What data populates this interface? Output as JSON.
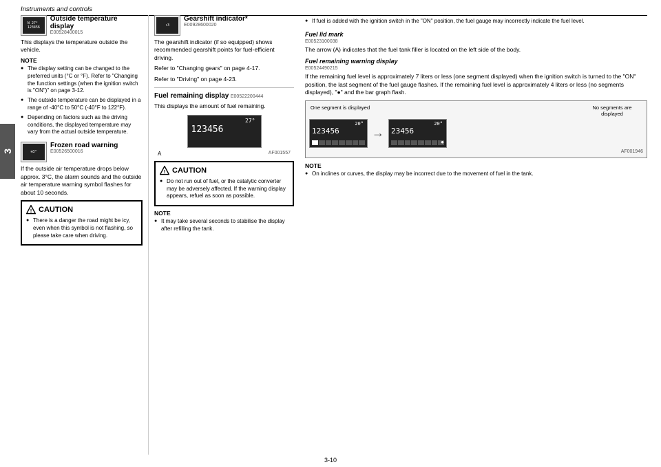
{
  "header": {
    "title": "Instruments and controls"
  },
  "footer": {
    "page_number": "3-10"
  },
  "sidebar": {
    "tab_label": "3"
  },
  "left_column": {
    "outside_temp_section": {
      "title": "Outside temperature display",
      "code": "E00528400015",
      "body": "This displays the temperature outside the vehicle.",
      "note_label": "NOTE",
      "note_items": [
        "The display setting can be changed to the preferred units (°C or °F). Refer to \"Changing the function settings (when the ignition switch is \"ON\")\" on page 3-12.",
        "The outside temperature can be displayed in a range of -40°C to 50°C (-40°F to 122°F).",
        "Depending on factors such as the driving conditions, the displayed temperature may vary from the actual outside temperature."
      ]
    },
    "frozen_section": {
      "title": "Frozen road warning",
      "code": "E00526500016",
      "body": "If the outside air temperature drops below approx. 3°C, the alarm sounds and the outside air temperature warning symbol flashes for about 10 seconds.",
      "caution_title": "CAUTION",
      "caution_items": [
        "There is a danger the road might be icy, even when this symbol is not flashing, so please take care when driving."
      ]
    }
  },
  "mid_column": {
    "gearshift_section": {
      "title": "Gearshift indicator*",
      "code": "E00928600020",
      "body": "The gearshift indicator (if so equipped) shows recommended gearshift points for fuel-efficient driving.",
      "refer1": "Refer to \"Changing gears\" on page 4-17.",
      "refer2": "Refer to \"Driving\" on page 4-23."
    },
    "fuel_remaining_section": {
      "title": "Fuel remaining display",
      "code": "E00522200444",
      "body": "This displays the amount of fuel remaining.",
      "display_label": "A",
      "display_code": "AF001557",
      "caution_title": "CAUTION",
      "caution_items": [
        "Do not run out of fuel, or the catalytic converter may be adversely affected. If the warning display appears, refuel as soon as possible."
      ],
      "note_label": "NOTE",
      "note_items": [
        "It may take several seconds to stabilise the display after refilling the tank."
      ]
    }
  },
  "right_column": {
    "fuel_level_note": "If fuel is added with the ignition switch in the \"ON\" position, the fuel gauge may incorrectly indicate the fuel level.",
    "fuel_lid_mark": {
      "title": "Fuel lid mark",
      "code": "E00523100038",
      "body": "The arrow (A) indicates that the fuel tank filler is located on the left side of the body."
    },
    "fuel_warning_display": {
      "title": "Fuel remaining warning display",
      "code": "E00524490215",
      "body": "If the remaining fuel level is approximately 7 liters or less (one segment displayed) when the ignition switch is turned to the \"ON\" position, the last segment of the fuel gauge flashes. If the remaining fuel level is approximately 4 liters or less (no segments displayed), \"●\" and the bar graph flash.",
      "one_segment_label": "One segment is displayed",
      "no_segment_label": "No segments are displayed",
      "display_code": "AF001946"
    },
    "note_label": "NOTE",
    "note_items": [
      "On inclines or curves, the display may be incorrect due to the movement of fuel in the tank."
    ]
  }
}
